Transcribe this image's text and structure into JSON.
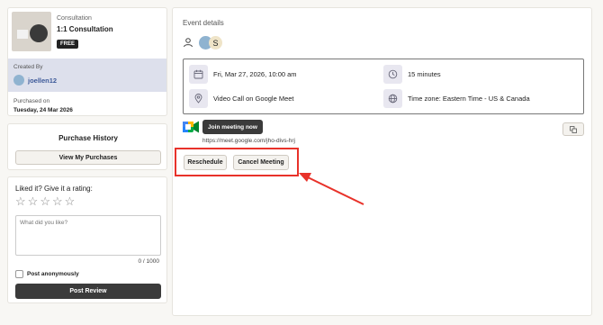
{
  "product": {
    "category": "Consultation",
    "title": "1:1 Consultation",
    "price_badge": "FREE"
  },
  "creator": {
    "created_by_label": "Created By",
    "username": "joellen12",
    "purchased_on_label": "Purchased on",
    "purchased_on_value": "Tuesday, 24 Mar 2026"
  },
  "purchase_history": {
    "title": "Purchase History",
    "button_label": "View My Purchases"
  },
  "rating": {
    "prompt": "Liked it? Give it a rating:",
    "stars": 5,
    "filled": 0,
    "review_placeholder": "What did you like?",
    "char_count": "0 / 1000",
    "anonymous_label": "Post anonymously",
    "submit_label": "Post Review"
  },
  "event": {
    "section_title": "Event details",
    "host_initial": "S",
    "datetime": "Fri, Mar 27, 2026, 10:00 am",
    "duration": "15 minutes",
    "location": "Video Call on Google Meet",
    "timezone": "Time zone: Eastern Time - US & Canada",
    "join_label": "Join meeting now",
    "meeting_url": "https://meet.google.com/jho-divs-hrj",
    "reschedule_label": "Reschedule",
    "cancel_label": "Cancel Meeting"
  },
  "colors": {
    "annotation": "#e8322a",
    "creator_bg": "#dde0ec",
    "username": "#3d5a99"
  }
}
